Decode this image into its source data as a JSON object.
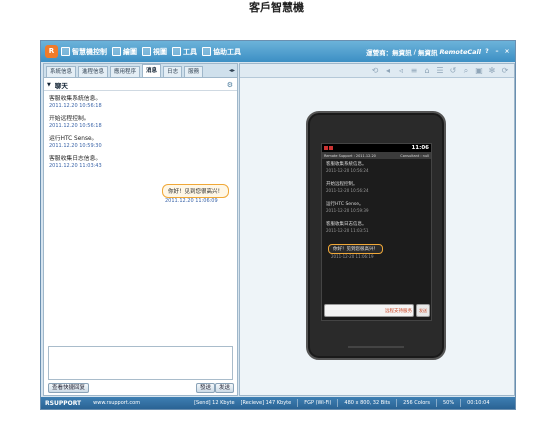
{
  "page_title": "客戶智慧機",
  "app": {
    "logo_text": "R",
    "menu": [
      {
        "label": "智慧機控制",
        "icon": "phone-control-icon"
      },
      {
        "label": "繪圖",
        "icon": "draw-icon"
      },
      {
        "label": "視圖",
        "icon": "view-icon"
      },
      {
        "label": "工具",
        "icon": "tools-icon"
      },
      {
        "label": "協助工具",
        "icon": "help-tools-icon"
      }
    ],
    "title_right": {
      "operator": "運營商：無資訊",
      "wifi": "無資訊",
      "brand": "RemoteCall",
      "help": "?",
      "minimize": "–",
      "close": "×"
    }
  },
  "left_panel": {
    "tabs": [
      "系統信息",
      "進程信息",
      "應用程序",
      "消息",
      "日志",
      "服務"
    ],
    "active_tab": "消息",
    "chat_header": "聊天",
    "messages": [
      {
        "text": "客服收集系統信息。",
        "time": "2011.12.20 10:56:18"
      },
      {
        "text": "开始远程控制。",
        "time": "2011.12.20 10:56:18"
      },
      {
        "text": "运行HTC Sense。",
        "time": "2011.12.20 10:59:30"
      },
      {
        "text": "客服收集日志信息。",
        "time": "2011.12.20 11:03:43"
      }
    ],
    "bubble": {
      "text": "你好！见到您很高兴！",
      "time": "2011.12.20 11:06:09"
    },
    "buttons": {
      "view_quick": "查看快捷回复",
      "send_file": "發送",
      "send": "发送"
    }
  },
  "right_panel": {
    "toolbar_icons": [
      "rotate-icon",
      "volume-icon",
      "volume-down-icon",
      "menu-icon",
      "home-icon",
      "settings-icon",
      "back-icon",
      "search-icon",
      "camera-icon",
      "gear-icon",
      "refresh-icon"
    ],
    "phone": {
      "status_time": "11:06",
      "header_left": "Remote Support : 2011.12.20",
      "header_right": "Consultant : null",
      "messages": [
        {
          "text": "客服收集系統信息。",
          "time": "2011-12-20 10:56:24"
        },
        {
          "text": "开始远程控制。",
          "time": "2011-12-20 10:56:24"
        },
        {
          "text": "运行HTC Sense。",
          "time": "2011-12-20 10:59:39"
        },
        {
          "text": "客服收集日志信息。",
          "time": "2011-12-20 11:03:51"
        }
      ],
      "bubble": {
        "text": "你好！见到您很高兴！",
        "time": "2011-12-20 11:06:19"
      },
      "input_text": "远程支持服务",
      "send_label": "发送"
    }
  },
  "statusline": {
    "logo": "RSUPPORT",
    "url": "www.rsupport.com",
    "send": "[Send] 12 Kbyte",
    "receive": "[Recieve] 147 Kbyte",
    "fps": "FGP (Wi-Fi)",
    "resolution": "480 x 800, 32 Bits",
    "colors": "256 Colors",
    "zoom": "50%",
    "timer": "00:10:04"
  }
}
